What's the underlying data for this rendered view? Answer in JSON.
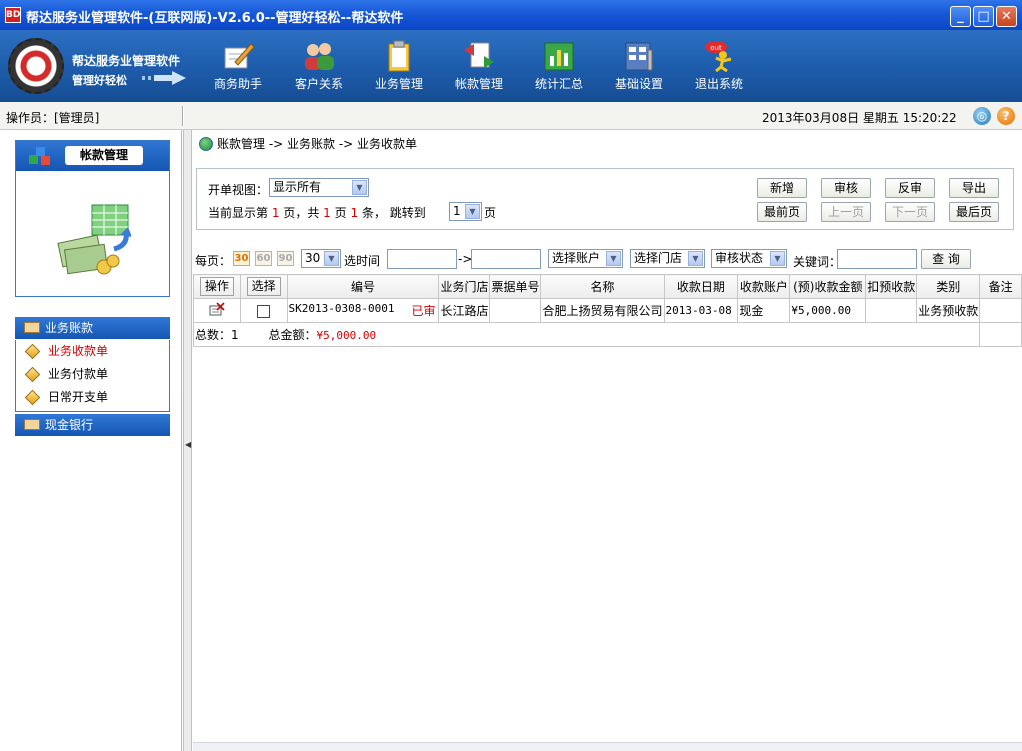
{
  "window": {
    "app_icon_text": "BD",
    "title": "帮达服务业管理软件-(互联网版)-V2.6.0--管理好轻松--帮达软件",
    "minimize": "_",
    "maximize": "□",
    "close": "✕"
  },
  "banner": {
    "logo_title": "帮达服务业管理软件",
    "logo_sub": "管理好轻松",
    "tools": [
      "商务助手",
      "客户关系",
      "业务管理",
      "帐款管理",
      "统计汇总",
      "基础设置",
      "退出系统"
    ],
    "exit_icon_text": "out"
  },
  "infobar": {
    "operator": "操作员：[管理员]",
    "datetime": "2013年03月08日  星期五  15:20:22"
  },
  "sidebar": {
    "card_title": "帐款管理",
    "group1": "业务账款",
    "items": [
      "业务收款单",
      "业务付款单",
      "日常开支单"
    ],
    "group2": "现金银行"
  },
  "breadcrumb": "账款管理 -> 业务账款 -> 业务收款单",
  "filter": {
    "view_label": "开单视图：",
    "view_value": "显示所有",
    "page_prefix": "当前显示第",
    "page_current": "1",
    "page_mid1": "页，共",
    "page_total": "1",
    "page_mid2": "页",
    "record_count": "1",
    "page_mid3": "条，  跳转到",
    "jump_value": "1",
    "page_suffix": "页",
    "buttons": {
      "new": "新增",
      "audit": "审核",
      "unaudit": "反审",
      "export": "导出",
      "first": "最前页",
      "prev": "上一页",
      "next": "下一页",
      "last": "最后页"
    }
  },
  "toolbar": {
    "per_page_label": "每页：",
    "sizes": [
      "30",
      "60",
      "90"
    ],
    "per_page_select": "30",
    "time_label": "选时间",
    "arrow": "->",
    "account_select": "选择账户",
    "store_select": "选择门店",
    "status_select": "审核状态",
    "keyword_label": "关键词：",
    "query": "查 询"
  },
  "table": {
    "headers": [
      "操作",
      "选择",
      "编号",
      "业务门店",
      "票据单号",
      "名称",
      "收款日期",
      "收款账户",
      "(预)收款金额",
      "扣预收款",
      "类别",
      "备注"
    ],
    "rows": [
      {
        "number": "SK2013-0308-0001",
        "status": "已审",
        "store": "长江路店",
        "ticket": "",
        "name": "合肥上扬贸易有限公司",
        "date": "2013-03-08",
        "account": "现金",
        "amount": "¥5,000.00",
        "deduct": "",
        "category": "业务预收款",
        "note": ""
      }
    ],
    "summary_count": "总数：1",
    "summary_amount_label": "总金额：",
    "summary_amount": "¥5,000.00"
  },
  "colors": {
    "title_bar": "#1658d6",
    "banner": "#1c5aa8",
    "accent_red": "#d40000"
  }
}
